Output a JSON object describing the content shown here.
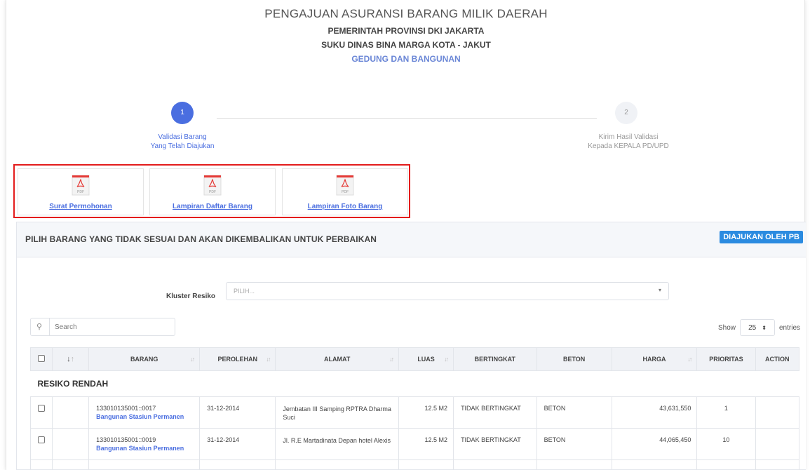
{
  "header": {
    "title": "PENGAJUAN ASURANSI BARANG MILIK DAERAH",
    "subtitle1": "PEMERINTAH PROVINSI DKI JAKARTA",
    "subtitle2": "SUKU DINAS BINA MARGA KOTA - JAKUT",
    "subtitle3": "GEDUNG DAN BANGUNAN"
  },
  "stepper": {
    "steps": [
      {
        "number": "1",
        "line1": "Validasi Barang",
        "line2": "Yang Telah Diajukan"
      },
      {
        "number": "2",
        "line1": "Kirim Hasil Validasi",
        "line2": "Kepada KEPALA PD/UPD"
      }
    ]
  },
  "documents": [
    {
      "label": "Surat Permohonan",
      "icon": "pdf-file-icon"
    },
    {
      "label": "Lampiran Daftar Barang",
      "icon": "pdf-file-icon"
    },
    {
      "label": "Lampiran Foto Barang",
      "icon": "pdf-file-icon"
    }
  ],
  "pdf_icon_text": "PDF",
  "panel": {
    "title": "PILIH BARANG YANG TIDAK SESUAI DAN AKAN DIKEMBALIKAN UNTUK PERBAIKAN",
    "badge": "DIAJUKAN OLEH PB"
  },
  "filter": {
    "label": "Kluster Resiko",
    "placeholder": "PILIH..."
  },
  "search": {
    "placeholder": "Search"
  },
  "entries": {
    "show": "Show",
    "value": "25",
    "suffix": "entries"
  },
  "table": {
    "columns": [
      "BARANG",
      "PEROLEHAN",
      "ALAMAT",
      "LUAS",
      "BERTINGKAT",
      "BETON",
      "HARGA",
      "PRIORITAS",
      "ACTION"
    ],
    "group": "RESIKO RENDAH",
    "rows": [
      {
        "kode": "133010135001::0017",
        "nama": "Bangunan Stasiun Permanen",
        "perolehan": "31-12-2014",
        "alamat": "Jembatan III Samping RPTRA Dharma Suci",
        "luas": "12.5 M2",
        "bertingkat": "TIDAK BERTINGKAT",
        "beton": "BETON",
        "harga": "43,631,550",
        "prioritas": "1",
        "action": ""
      },
      {
        "kode": "133010135001::0019",
        "nama": "Bangunan Stasiun Permanen",
        "perolehan": "31-12-2014",
        "alamat": "Jl. R.E Martadinata Depan hotel Alexis",
        "luas": "12.5 M2",
        "bertingkat": "TIDAK BERTINGKAT",
        "beton": "BETON",
        "harga": "44,065,450",
        "prioritas": "10",
        "action": ""
      }
    ]
  },
  "colors": {
    "primary": "#4a6ee0",
    "badge": "#2b8be0",
    "highlight_border": "#e31c1c"
  }
}
